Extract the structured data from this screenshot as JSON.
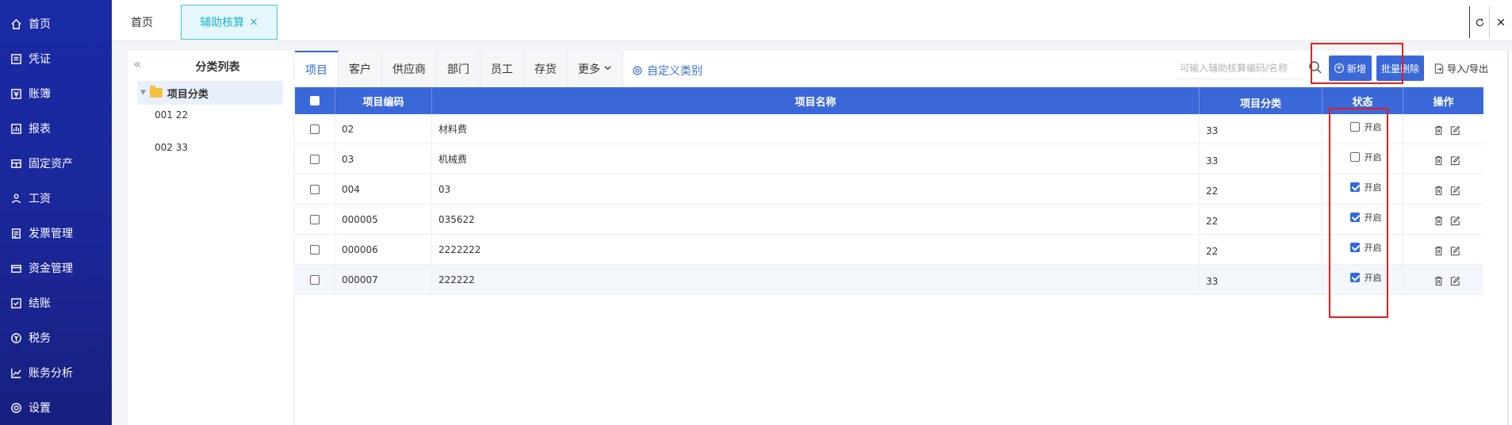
{
  "sidebar": {
    "items": [
      {
        "label": "首页",
        "icon": "home-icon"
      },
      {
        "label": "凭证",
        "icon": "voucher-icon"
      },
      {
        "label": "账簿",
        "icon": "ledger-icon"
      },
      {
        "label": "报表",
        "icon": "report-icon"
      },
      {
        "label": "固定资产",
        "icon": "asset-icon"
      },
      {
        "label": "工资",
        "icon": "salary-icon"
      },
      {
        "label": "发票管理",
        "icon": "invoice-icon"
      },
      {
        "label": "资金管理",
        "icon": "fund-icon"
      },
      {
        "label": "结账",
        "icon": "closing-icon"
      },
      {
        "label": "税务",
        "icon": "tax-icon"
      },
      {
        "label": "账务分析",
        "icon": "analysis-icon"
      },
      {
        "label": "设置",
        "icon": "settings-icon"
      }
    ]
  },
  "topbar": {
    "home_tab": "首页",
    "active_tab": "辅助核算",
    "close_glyph": "×"
  },
  "category": {
    "title": "分类列表",
    "root": "项目分类",
    "children": [
      "001 22",
      "002 33"
    ]
  },
  "subtabs": [
    "项目",
    "客户",
    "供应商",
    "部门",
    "员工",
    "存货",
    "更多"
  ],
  "custom_category": "自定义类别",
  "search": {
    "placeholder": "可输入辅助核算编码/名称"
  },
  "buttons": {
    "new": "新增",
    "batch_delete": "批量删除",
    "import_export": "导入/导出"
  },
  "table": {
    "headers": [
      "项目编码",
      "项目名称",
      "项目分类",
      "状态",
      "操作"
    ],
    "status_label": "开启",
    "rows": [
      {
        "code": "02",
        "name": "材料费",
        "category": "33",
        "enabled": false
      },
      {
        "code": "03",
        "name": "机械费",
        "category": "33",
        "enabled": false
      },
      {
        "code": "004",
        "name": "03",
        "category": "22",
        "enabled": true
      },
      {
        "code": "000005",
        "name": "035622",
        "category": "22",
        "enabled": true
      },
      {
        "code": "000006",
        "name": "2222222",
        "category": "22",
        "enabled": true
      },
      {
        "code": "000007",
        "name": "222222",
        "category": "33",
        "enabled": true
      }
    ]
  },
  "colors": {
    "sidebar": "#1a2aa6",
    "header": "#3b68d8",
    "accent": "#2f6bd8",
    "highlight": "#e21e1e",
    "active_tab": "#1fb3c9"
  }
}
